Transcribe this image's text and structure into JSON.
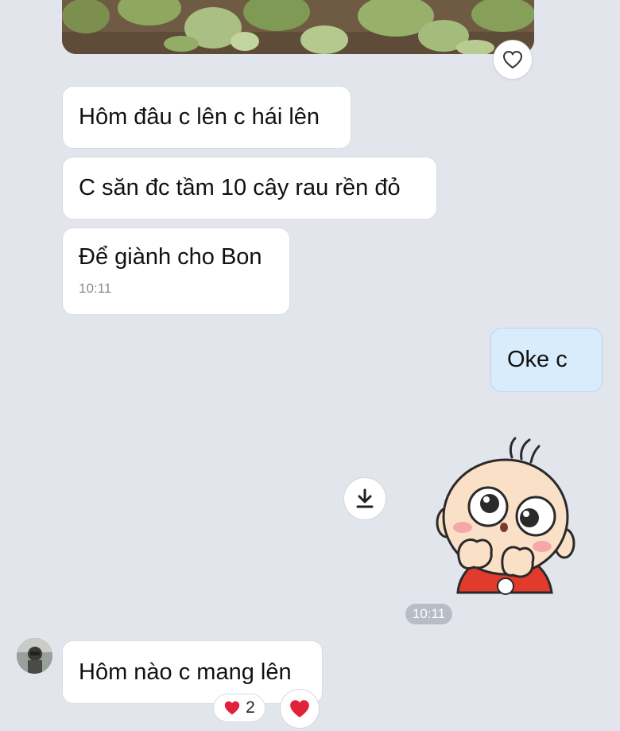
{
  "messages": [
    {
      "text": "Hôm đâu c lên c hái lên"
    },
    {
      "text": "C săn đc tầm 10 cây rau rền đỏ"
    },
    {
      "text": "Để giành cho Bon",
      "time": "10:11"
    },
    {
      "text": "Oke c"
    },
    {
      "text": "Hôm nào c mang lên"
    }
  ],
  "sticker_time": "10:11",
  "reaction": {
    "count": "2",
    "color": "#e0223a"
  },
  "icons": {
    "photo_react": "heart-outline-icon",
    "download": "download-icon",
    "message_react": "heart-icon"
  },
  "colors": {
    "background": "#e2e5ec",
    "incoming_bubble": "#ffffff",
    "outgoing_bubble": "#d8ecfb",
    "time_pill": "#b8bcc4"
  }
}
